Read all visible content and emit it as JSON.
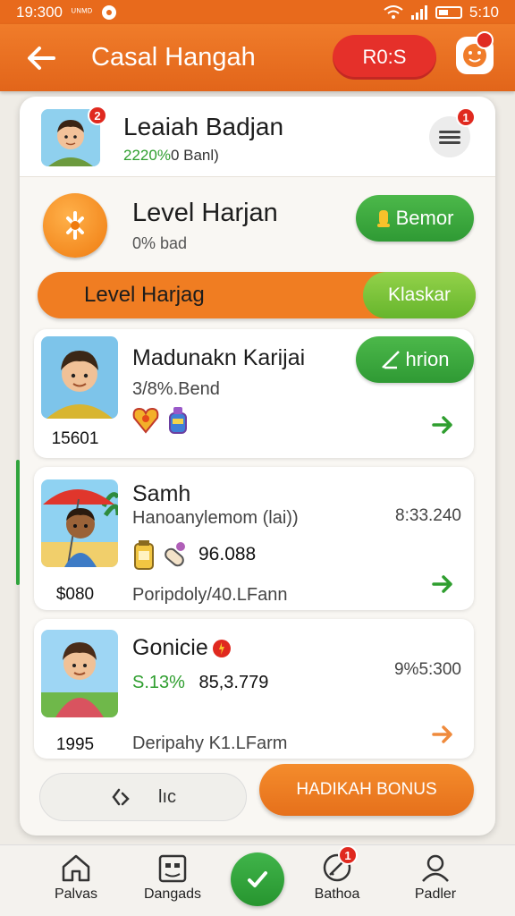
{
  "status_bar": {
    "time": "19:300",
    "carrier": "ᵁᴺᴹᴰ",
    "clock": "5:10"
  },
  "app_bar": {
    "title": "Casal Hangah",
    "pill_label": "R0:S"
  },
  "profile": {
    "name": "Leaiah Badjan",
    "sub_green": "2220%",
    "sub_rest": "0 Banl)",
    "avatar_badge": "2",
    "menu_badge": "1"
  },
  "level": {
    "title": "Level Harjan",
    "sub": "0% bad",
    "button_label": "Bemor"
  },
  "banner": {
    "label": "Level Harjag",
    "button_label": "Klaskar"
  },
  "tasks": [
    {
      "name": "Madunakn Karijai",
      "sub": "3/8%.Bend",
      "value": "15601",
      "button_label": "hrion"
    },
    {
      "name": "Samh",
      "sub": "Hanoanylemom (lai))",
      "time": "8:33.240",
      "amount": "96.088",
      "value": "$080",
      "footer": "Poripdoly/40.LFann"
    },
    {
      "name": "Gonicie",
      "sub_green": "S.13%",
      "amount": "85,3.779",
      "time": "9%5:300",
      "value": "1995",
      "footer": "Deripahy K1.LFarm"
    }
  ],
  "actions": {
    "secondary_label": "lıc",
    "primary_label": "HADIKAH BONUS"
  },
  "nav": [
    {
      "label": "Palvas",
      "icon": "home-icon"
    },
    {
      "label": "Dangads",
      "icon": "calendar-icon"
    },
    {
      "label": "",
      "icon": "check-icon"
    },
    {
      "label": "Bathoa",
      "icon": "pencil-icon",
      "badge": "1"
    },
    {
      "label": "Padler",
      "icon": "user-icon"
    }
  ],
  "colors": {
    "primary": "#e86a1c",
    "green": "#2f9a34",
    "red": "#e5302a",
    "lime": "#66b52c"
  }
}
